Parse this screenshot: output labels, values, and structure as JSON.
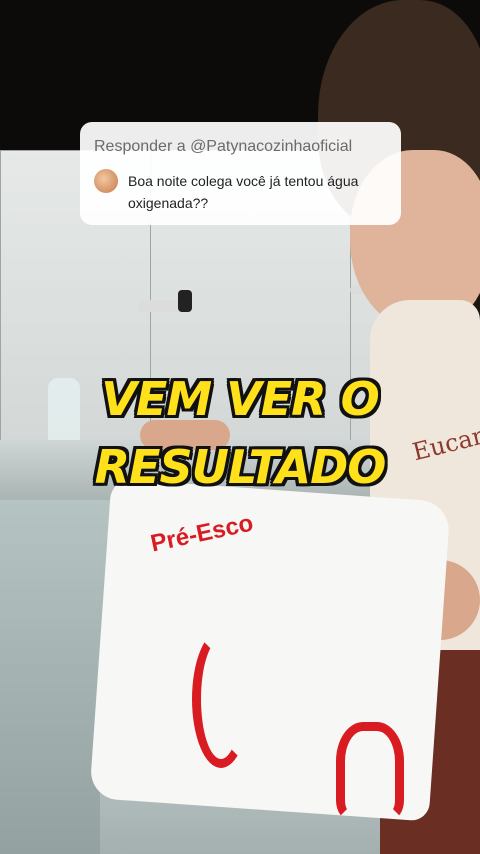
{
  "reply": {
    "header": "Responder a @Patynacozinhaoficial",
    "comment": "Boa noite colega você já tentou água oxigenada??"
  },
  "caption": {
    "line1": "VEM VER O",
    "line2": "RESULTADO"
  },
  "garment_print": "Pré-Esco",
  "shirt_print": "Eucar",
  "colors": {
    "caption_text": "#ffe11b",
    "caption_outline": "#111111",
    "garment_trim": "#d81c22"
  }
}
